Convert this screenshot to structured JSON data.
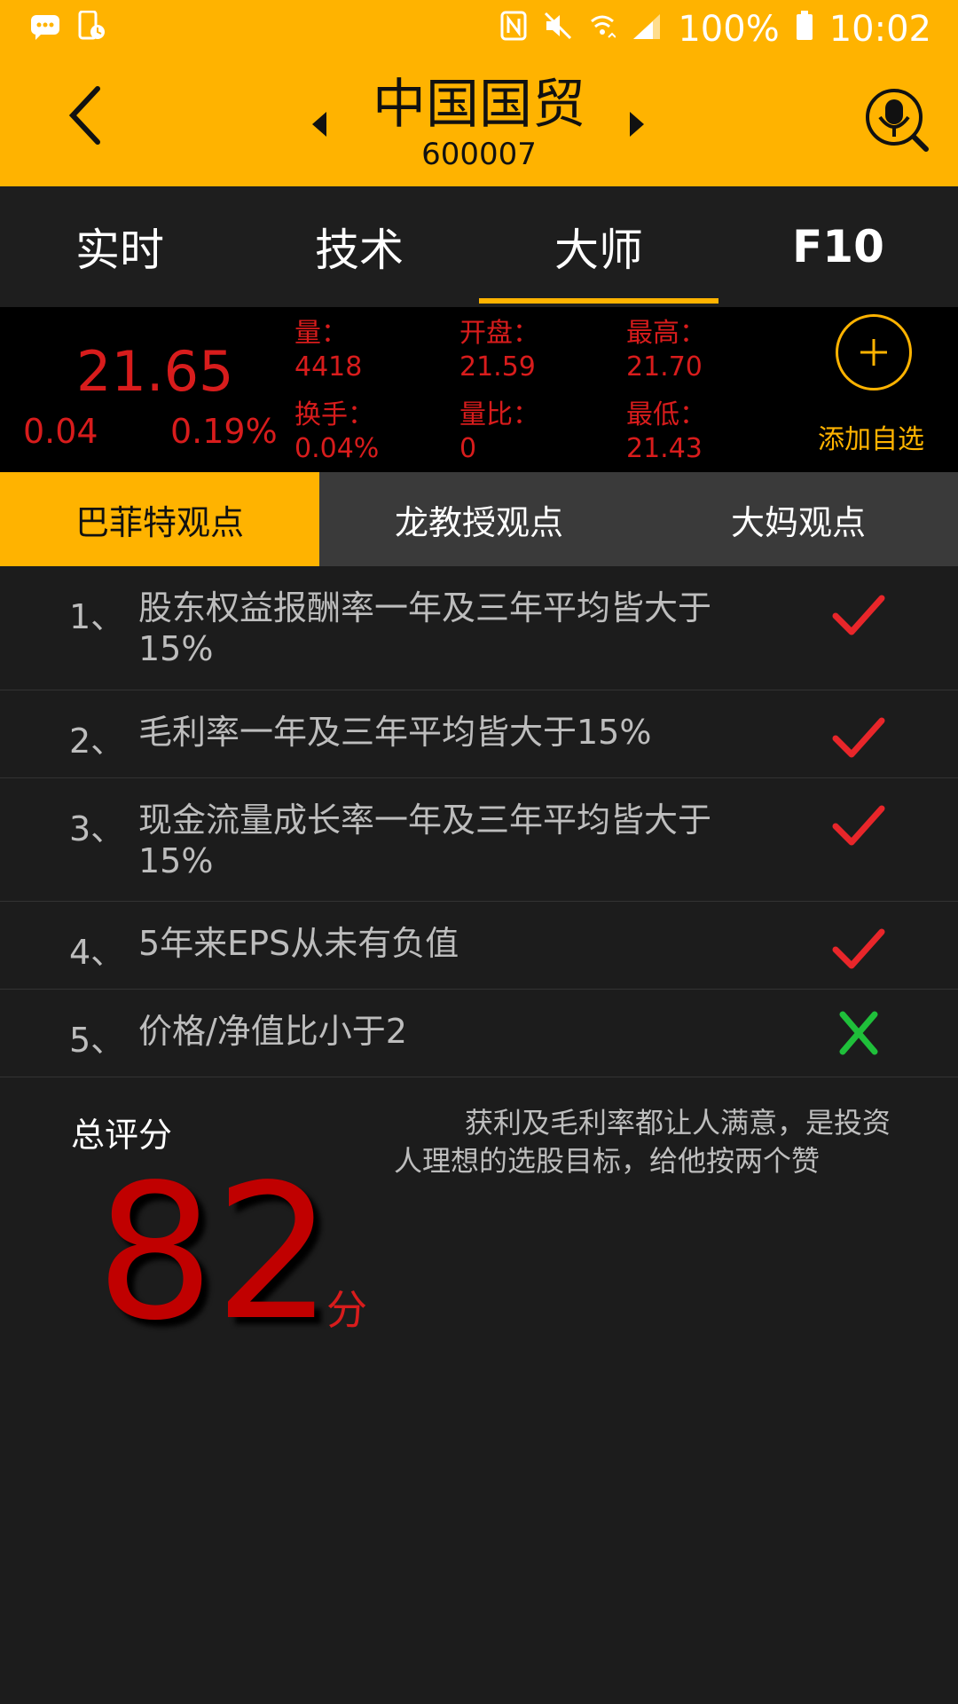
{
  "status_bar": {
    "battery_text": "100%",
    "time": "10:02",
    "icons": [
      "message-icon",
      "phone-alarm-icon",
      "nfc-icon",
      "mute-icon",
      "wifi-icon",
      "signal-icon",
      "battery-icon"
    ]
  },
  "header": {
    "stock_name": "中国国贸",
    "stock_code": "600007",
    "icons": [
      "back-chevron-icon",
      "prev-arrow-icon",
      "next-arrow-icon",
      "voice-search-icon"
    ]
  },
  "tabs": [
    {
      "label": "实时"
    },
    {
      "label": "技术"
    },
    {
      "label": "大师",
      "active": true
    },
    {
      "label": "F10"
    }
  ],
  "quote": {
    "price": "21.65",
    "change": "0.04",
    "change_pct": "0.19%",
    "volume_label": "量：",
    "volume": "4418",
    "turnover_label": "换手：",
    "turnover": "0.04%",
    "open_label": "开盘：",
    "open": "21.59",
    "vol_ratio_label": "量比：",
    "vol_ratio": "0",
    "high_label": "最高：",
    "high": "21.70",
    "low_label": "最低：",
    "low": "21.43",
    "add_label": "添加自选",
    "color_down_up": "#d81c1c",
    "accent": "#FFB300"
  },
  "subtabs": [
    {
      "label": "巴菲特观点",
      "active": true
    },
    {
      "label": "龙教授观点"
    },
    {
      "label": "大妈观点"
    }
  ],
  "criteria": [
    {
      "num": "1、",
      "text": "股东权益报酬率一年及三年平均皆大于15%",
      "pass": true
    },
    {
      "num": "2、",
      "text": "毛利率一年及三年平均皆大于15%",
      "pass": true
    },
    {
      "num": "3、",
      "text": "现金流量成长率一年及三年平均皆大于15%",
      "pass": true
    },
    {
      "num": "4、",
      "text": "5年来EPS从未有负值",
      "pass": true
    },
    {
      "num": "5、",
      "text": "价格/净值比小于2",
      "pass": false
    }
  ],
  "score": {
    "label": "总评分",
    "value": "82",
    "unit": "分",
    "comment": "获利及毛利率都让人满意，是投资人理想的选股目标，给他按两个赞"
  }
}
